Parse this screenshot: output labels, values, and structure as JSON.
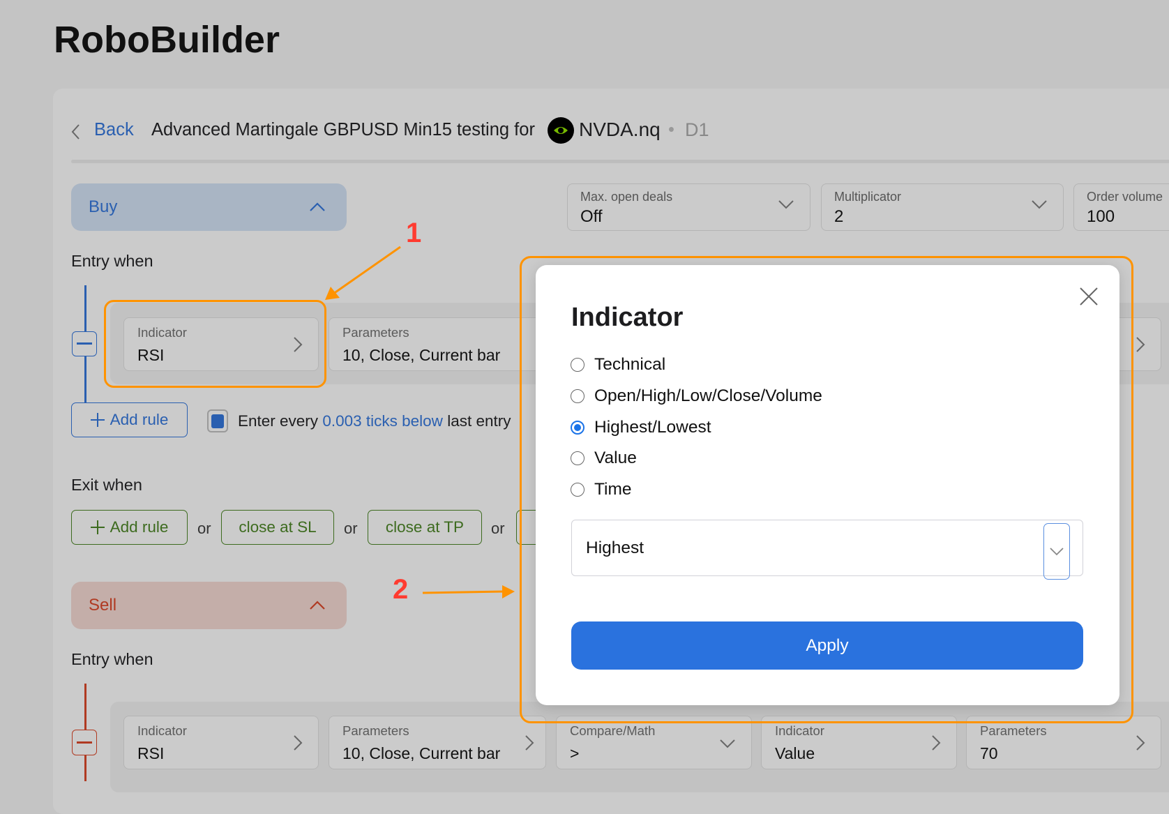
{
  "app_title": "RoboBuilder",
  "header": {
    "back": "Back",
    "strategy": "Advanced Martingale GBPUSD Min15 testing for",
    "symbol": "NVDA.nq",
    "separator": "•",
    "timeframe": "D1"
  },
  "settings": [
    {
      "label": "Max. open deals",
      "value": "Off"
    },
    {
      "label": "Multiplicator",
      "value": "2"
    },
    {
      "label": "Order volume",
      "value": "100"
    }
  ],
  "buy": {
    "label": "Buy",
    "entry_label": "Entry when",
    "rule": [
      {
        "label": "Indicator",
        "value": "RSI"
      },
      {
        "label": "Parameters",
        "value": "10, Close, Current bar"
      }
    ],
    "add_rule": "Add rule",
    "enter_every_pre": "Enter every",
    "enter_every_link": "0.003 ticks below",
    "enter_every_post": "last entry",
    "exit_label": "Exit when",
    "exit_add_rule": "Add rule",
    "or": "or",
    "close_sl": "close at SL",
    "close_tp": "close at TP"
  },
  "sell": {
    "label": "Sell",
    "entry_label": "Entry when",
    "rule": [
      {
        "label": "Indicator",
        "value": "RSI"
      },
      {
        "label": "Parameters",
        "value": "10, Close, Current bar"
      },
      {
        "label": "Compare/Math",
        "value": ">"
      },
      {
        "label": "Indicator",
        "value": "Value"
      },
      {
        "label": "Parameters",
        "value": "70"
      }
    ]
  },
  "annotations": {
    "one": "1",
    "two": "2"
  },
  "modal": {
    "title": "Indicator",
    "options": [
      "Technical",
      "Open/High/Low/Close/Volume",
      "Highest/Lowest",
      "Value",
      "Time"
    ],
    "selected_index": 2,
    "select_value": "Highest",
    "apply": "Apply"
  },
  "colors": {
    "accent": "#2a72de",
    "highlight": "#ff9300",
    "annotation": "#ff3b30",
    "buy": "#2a5fb0",
    "sell": "#b03a22",
    "exit": "#3d6b1f"
  }
}
